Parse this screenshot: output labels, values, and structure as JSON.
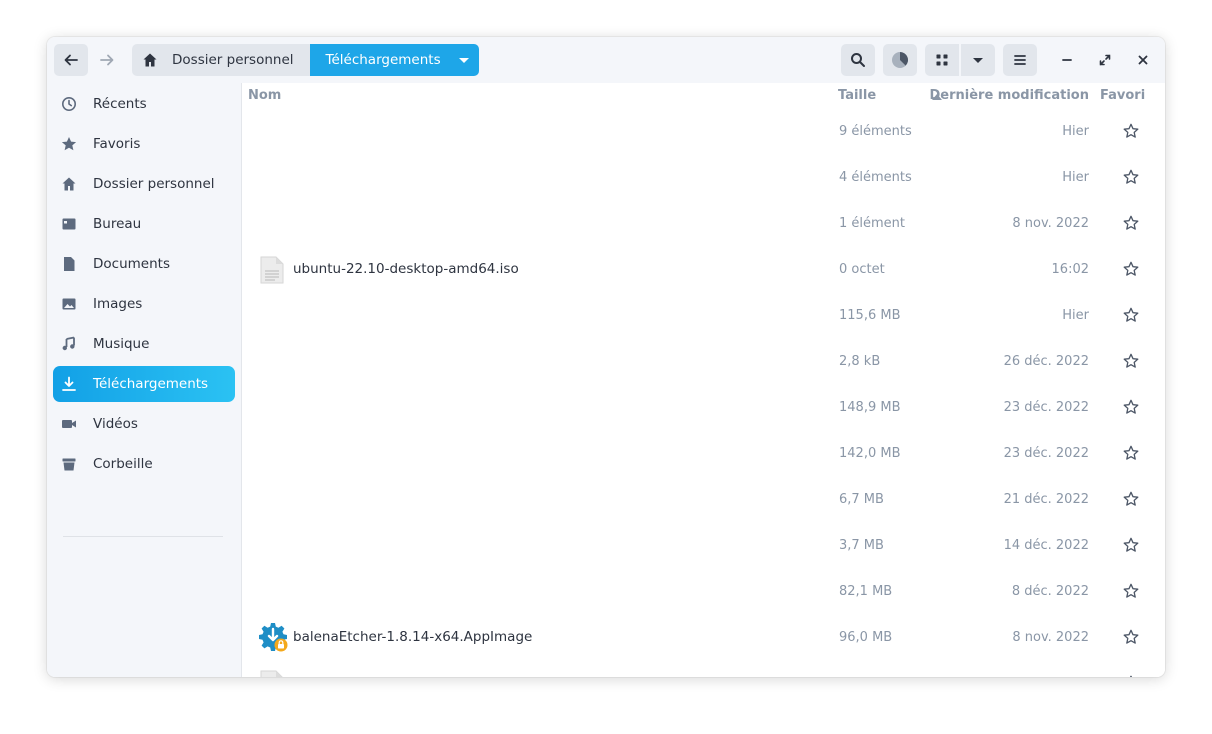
{
  "breadcrumb": {
    "home_label": "Dossier personnel",
    "current_label": "Téléchargements"
  },
  "sidebar": {
    "items": [
      {
        "label": "Récents",
        "icon": "clock-icon"
      },
      {
        "label": "Favoris",
        "icon": "star-icon"
      },
      {
        "label": "Dossier personnel",
        "icon": "home-icon"
      },
      {
        "label": "Bureau",
        "icon": "desktop-icon"
      },
      {
        "label": "Documents",
        "icon": "document-icon"
      },
      {
        "label": "Images",
        "icon": "image-icon"
      },
      {
        "label": "Musique",
        "icon": "music-icon"
      },
      {
        "label": "Téléchargements",
        "icon": "download-icon"
      },
      {
        "label": "Vidéos",
        "icon": "video-icon"
      },
      {
        "label": "Corbeille",
        "icon": "trash-icon"
      }
    ]
  },
  "columns": {
    "name": "Nom",
    "size": "Taille",
    "modified": "Dernière modification",
    "favorite": "Favori"
  },
  "files": [
    {
      "name": "",
      "size": "9 éléments",
      "modified": "Hier"
    },
    {
      "name": "",
      "size": "4 éléments",
      "modified": "Hier"
    },
    {
      "name": "",
      "size": "1 élément",
      "modified": "8 nov. 2022"
    },
    {
      "name": "ubuntu-22.10-desktop-amd64.iso",
      "size": "0 octet",
      "modified": "16:02"
    },
    {
      "name": "",
      "size": "115,6 MB",
      "modified": "Hier"
    },
    {
      "name": "",
      "size": "2,8 kB",
      "modified": "26 déc. 2022"
    },
    {
      "name": "",
      "size": "148,9 MB",
      "modified": "23 déc. 2022"
    },
    {
      "name": "",
      "size": "142,0 MB",
      "modified": "23 déc. 2022"
    },
    {
      "name": "",
      "size": "6,7 MB",
      "modified": "21 déc. 2022"
    },
    {
      "name": "",
      "size": "3,7 MB",
      "modified": "14 déc. 2022"
    },
    {
      "name": "",
      "size": "82,1 MB",
      "modified": "8 déc. 2022"
    },
    {
      "name": "balenaEtcher-1.8.14-x64.AppImage",
      "size": "96,0 MB",
      "modified": "8 nov. 2022"
    }
  ],
  "colors": {
    "accent": "#1ea6e8",
    "sidebar_bg": "#f4f6fa",
    "muted_text": "#8a96a6"
  }
}
